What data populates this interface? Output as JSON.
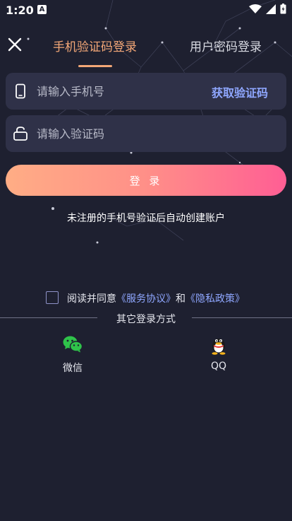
{
  "status_bar": {
    "time": "1:20",
    "keyboard_indicator": "A"
  },
  "tabs": [
    {
      "label": "手机验证码登录",
      "active": true
    },
    {
      "label": "用户密码登录",
      "active": false
    }
  ],
  "phone_input": {
    "placeholder": "请输入手机号",
    "value": ""
  },
  "get_code_label": "获取验证码",
  "code_input": {
    "placeholder": "请输入验证码",
    "value": ""
  },
  "login_label": "登 录",
  "auto_register_note": "未注册的手机号验证后自动创建账户",
  "agreement": {
    "prefix": "阅读并同意",
    "service_link": "《服务协议》",
    "joiner": "和",
    "privacy_link": "《隐私政策》"
  },
  "other_login_title": "其它登录方式",
  "social": [
    {
      "label": "微信",
      "icon": "wechat-icon"
    },
    {
      "label": "QQ",
      "icon": "qq-icon"
    }
  ],
  "colors": {
    "background": "#1e2030",
    "input_bg": "#2f3148",
    "active_tab": "#f3a777",
    "link": "#8fa7ff",
    "button_gradient_start": "#ffad85",
    "button_gradient_end": "#ff5e94"
  }
}
